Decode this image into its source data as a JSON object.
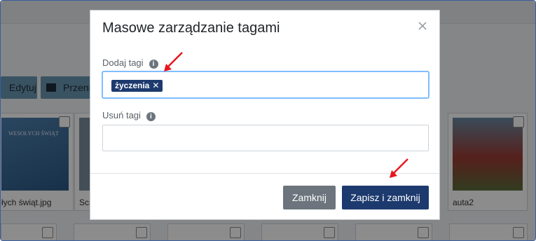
{
  "background": {
    "toolbar": {
      "edit_label": "Edytuj",
      "move_label": "Przeni"
    },
    "cards": [
      {
        "caption": "łych świąt.jpg",
        "thumb_text": "WESOŁYCH ŚWIĄT"
      },
      {
        "caption": "Scre"
      },
      {
        "caption": "auta2"
      }
    ]
  },
  "modal": {
    "title": "Masowe zarządzanie tagami",
    "add_tags": {
      "label": "Dodaj tagi",
      "tags": [
        "życzenia"
      ],
      "value": ""
    },
    "remove_tags": {
      "label": "Usuń tagi",
      "value": ""
    },
    "buttons": {
      "close": "Zamknij",
      "save": "Zapisz i zamknij"
    }
  },
  "colors": {
    "primary": "#1d3a6e",
    "secondary": "#6c757d",
    "annotation_arrow": "#e8141b"
  }
}
